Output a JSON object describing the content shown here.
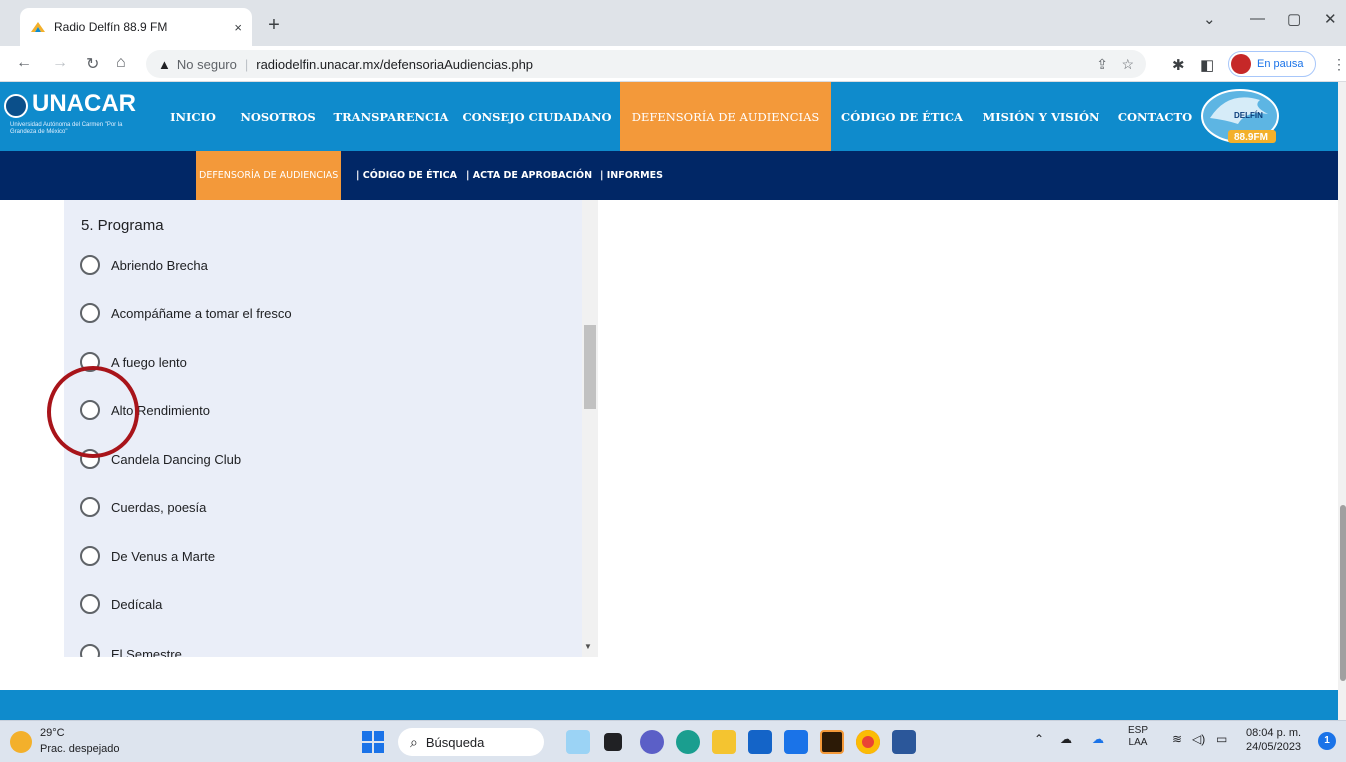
{
  "browser": {
    "tab_title": "Radio Delfín 88.9 FM",
    "tab_close": "×",
    "new_tab": "+",
    "window_controls": [
      "⌄",
      "—",
      "▢",
      "✕"
    ],
    "security_label": "No seguro",
    "url": "radiodelfin.unacar.mx/defensoriaAudiencias.php",
    "profile_label": "En pausa"
  },
  "site": {
    "logo_text": "UNACAR",
    "logo_subtitle": "Universidad Autónoma del Carmen \"Por la Grandeza de México\"",
    "nav": [
      "INICIO",
      "NOSOTROS",
      "TRANSPARENCIA",
      "CONSEJO CIUDADANO",
      "DEFENSORÍA DE AUDIENCIAS",
      "CÓDIGO DE ÉTICA",
      "MISIÓN Y VISIÓN",
      "CONTACTO"
    ],
    "active_nav": "DEFENSORÍA DE AUDIENCIAS",
    "radio_logo_text": "DELFÍN",
    "radio_logo_freq": "88.9FM",
    "subnav": [
      "DEFENSORÍA DE AUDIENCIAS",
      "| CÓDIGO DE ÉTICA",
      "| ACTA DE APROBACIÓN",
      "| INFORMES"
    ]
  },
  "form": {
    "question": "5. Programa",
    "options": [
      "Abriendo Brecha",
      "Acompáñame a tomar el fresco",
      "A fuego lento",
      "Alto Rendimiento",
      "Candela Dancing Club",
      "Cuerdas, poesía",
      "De Venus a Marte",
      "Dedícala",
      "El Semestre"
    ]
  },
  "taskbar": {
    "temperature": "29°C",
    "weather": "Prac. despejado",
    "search_placeholder": "Búsqueda",
    "lang_line1": "ESP",
    "lang_line2": "LAA",
    "time": "08:04 p. m.",
    "date": "24/05/2023",
    "notifications": "1"
  },
  "colors": {
    "header_blue": "#0f8bcc",
    "subnav_navy": "#012766",
    "accent_orange": "#f3993a",
    "form_bg": "#eaeef8",
    "highlight_red": "#a8141a"
  }
}
